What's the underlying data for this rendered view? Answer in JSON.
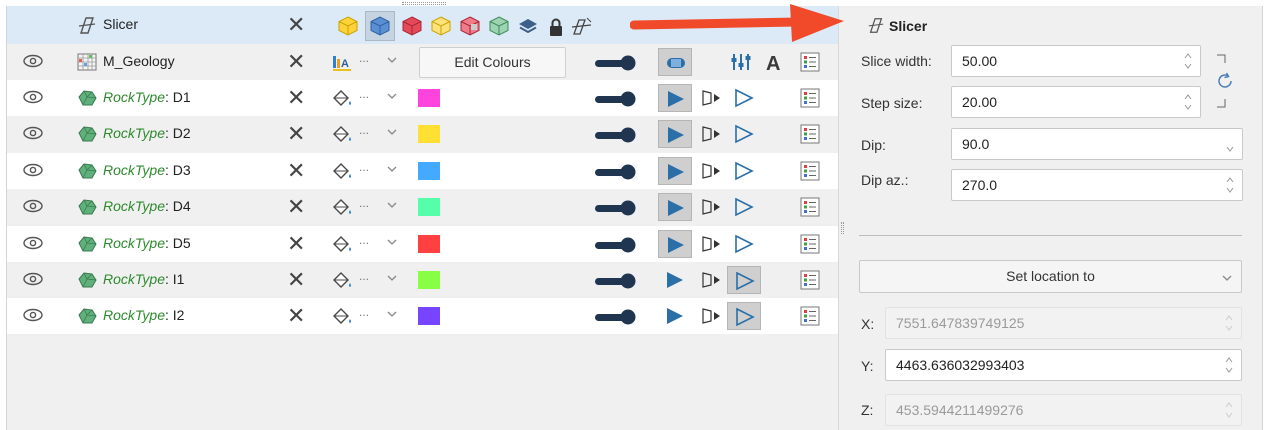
{
  "header": {
    "title": "Slicer",
    "toolbar_icons": [
      "yellow-cube-icon",
      "blue-cube-icon",
      "red-cube-icon",
      "yellow-cube-icon",
      "red-split-cube-icon",
      "green-cube-icon",
      "layers-icon",
      "lock-icon",
      "slicer-tool-icon"
    ]
  },
  "model_row": {
    "name": "M_Geology",
    "button_label": "Edit Colours",
    "dots": "..."
  },
  "layers": [
    {
      "prefix": "RockType",
      "suffix": ": D1",
      "color": "#ff44dd",
      "dots": "..."
    },
    {
      "prefix": "RockType",
      "suffix": ": D2",
      "color": "#ffe033",
      "dots": "..."
    },
    {
      "prefix": "RockType",
      "suffix": ": D3",
      "color": "#44aaff",
      "dots": "..."
    },
    {
      "prefix": "RockType",
      "suffix": ": D4",
      "color": "#55ffaa",
      "dots": "..."
    },
    {
      "prefix": "RockType",
      "suffix": ": D5",
      "color": "#ff4040",
      "dots": "..."
    },
    {
      "prefix": "RockType",
      "suffix": ": I1",
      "color": "#88ff44",
      "dots": "..."
    },
    {
      "prefix": "RockType",
      "suffix": ": I2",
      "color": "#7744ff",
      "dots": "..."
    }
  ],
  "panel": {
    "title": "Slicer",
    "slice_width_label": "Slice width:",
    "slice_width_value": "50.00",
    "step_size_label": "Step size:",
    "step_size_value": "20.00",
    "dip_label": "Dip:",
    "dip_value": "90.0",
    "dip_az_label": "Dip az.:",
    "dip_az_value": "270.0",
    "set_location_label": "Set location to",
    "x_label": "X:",
    "x_value": "7551.647839749125",
    "y_label": "Y:",
    "y_value": "4463.636032993403",
    "z_label": "Z:",
    "z_value": "453.5944211499276"
  },
  "colors": {
    "accent_arrow": "#f04a2a",
    "header_bg": "#dceaf8",
    "play_blue": "#2a6fa8"
  }
}
